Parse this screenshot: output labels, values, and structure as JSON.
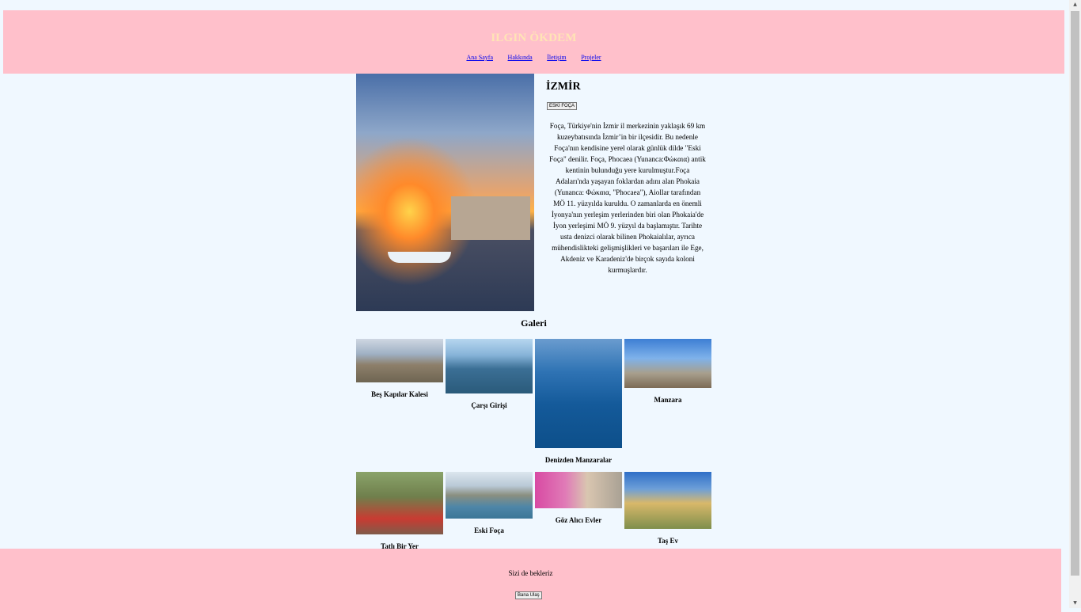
{
  "header": {
    "title": "ILGIN ÖKDEM",
    "nav": [
      "Ana Sayfa",
      "Hakkında",
      "İletişim",
      "Projeler"
    ]
  },
  "main": {
    "city": "İZMİR",
    "button_label": "ESKİ FOÇA",
    "description": "Foça, Türkiye'nin İzmir il merkezinin yaklaşık 69 km kuzeybatısında İzmir’in bir ilçesidir. Bu nedenle Foça'nın kendisine yerel olarak günlük dilde \"Eski Foça\" denilir. Foça, Phocaea (Yunanca:Φώκαια) antik kentinin bulunduğu yere kurulmuştur.Foça Adaları'nda yaşayan foklardan adını alan Phokaia (Yunanca: Φώκαια, \"Phocaea\"), Aiollar tarafından MÖ 11. yüzyılda kuruldu. O zamanlarda en önemli İyonya'nın yerleşim yerlerinden biri olan Phokaia'de İyon yerleşimi MÖ 9. yüzyıl da başlamıştır. Tarihte usta denizci olarak bilinen Phokaialılar, ayrıca mühendislikteki gelişmişlikleri ve başarıları ile Ege, Akdeniz ve Karadeniz'de birçok sayıda koloni kurmuşlardır."
  },
  "gallery": {
    "title": "Galeri",
    "items": [
      {
        "caption": "Beş Kapılar Kalesi"
      },
      {
        "caption": "Çarşı Girişi"
      },
      {
        "caption": "Denizden Manzaralar"
      },
      {
        "caption": "Manzara"
      },
      {
        "caption": "Tatlı Bir Yer"
      },
      {
        "caption": "Eski Foça"
      },
      {
        "caption": "Göz Alıcı Evler"
      },
      {
        "caption": "Taş Ev"
      }
    ]
  },
  "footer": {
    "text": "Sizi de bekleriz",
    "button_label": "Bana Ulaş"
  },
  "colors": {
    "header_bg": "#ffc0cb",
    "page_bg": "#f0f8ff",
    "title_color": "#ffe4b5"
  }
}
